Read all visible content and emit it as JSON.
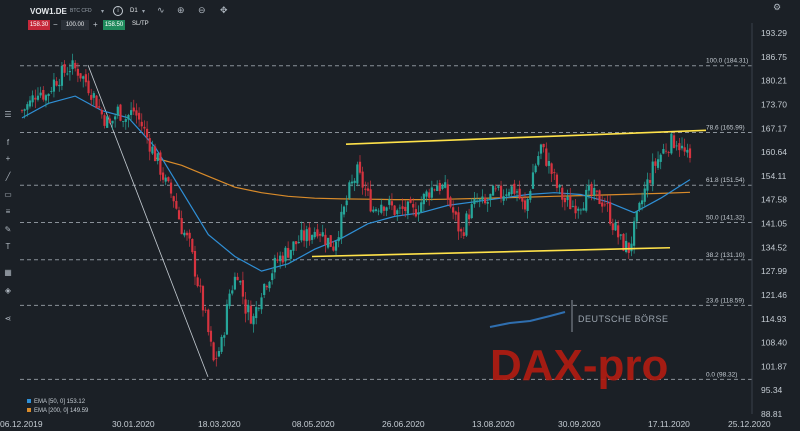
{
  "toolbar": {
    "symbol": "VOW1.DE",
    "symbol_sub": "BTC CFD",
    "timeframe": "D1",
    "sell_price": "158.30",
    "quantity": "100.00",
    "buy_price": "158.50",
    "sltp_label": "SL/TP",
    "minus": "−",
    "plus": "+",
    "icons": [
      "info-icon",
      "indicator-icon",
      "zoom-in-icon",
      "zoom-out-icon",
      "move-icon"
    ]
  },
  "sidebar_icons": [
    "menu-icon",
    "function-icon",
    "crosshair-icon",
    "line-icon",
    "rectangle-icon",
    "fibonacci-icon",
    "pen-icon",
    "text-icon",
    "grid-icon",
    "layers-icon",
    "share-icon"
  ],
  "settings_icon": "gear-icon",
  "colors": {
    "background": "#1b2026",
    "bull": "#26a69a",
    "bear": "#d6333f",
    "ema50": "#2f8fd6",
    "ema200": "#d98b2a",
    "channel": "#ffe24a",
    "fib": "#8a9199",
    "watermark": "#b01c12"
  },
  "legend": {
    "ema50": "EMA [50, 0] 153.12",
    "ema200": "EMA [200, 0] 149.59"
  },
  "watermark": {
    "deutsche": "DEUTSCHE BÖRSE",
    "daxpro": "DAX-pro"
  },
  "chart_data": {
    "type": "candlestick",
    "x_ticks": [
      "06.12.2019",
      "30.01.2020",
      "18.03.2020",
      "08.05.2020",
      "26.06.2020",
      "13.08.2020",
      "30.09.2020",
      "17.11.2020",
      "25.12.2020"
    ],
    "y_ticks": [
      193.29,
      186.75,
      180.21,
      173.7,
      167.17,
      160.64,
      154.11,
      147.58,
      141.05,
      134.52,
      127.99,
      121.46,
      114.93,
      108.4,
      101.87,
      95.34,
      88.81
    ],
    "ylim": [
      88.81,
      193.29
    ],
    "fib_levels": [
      {
        "label": "100.0 (184.31)",
        "value": 184.31
      },
      {
        "label": "78.6 (165.99)",
        "value": 165.99
      },
      {
        "label": "61.8 (151.54)",
        "value": 151.54
      },
      {
        "label": "50.0 (141.32)",
        "value": 141.32
      },
      {
        "label": "38.2 (131.10)",
        "value": 131.1
      },
      {
        "label": "23.6 (118.59)",
        "value": 118.59
      },
      {
        "label": "0.0 (98.32)",
        "value": 98.32
      }
    ],
    "channel": {
      "upper": {
        "start": [
          "08.05.2020",
          162.8
        ],
        "end": [
          "17.11.2020",
          166.6
        ]
      },
      "lower": {
        "start": [
          "08.05.2020",
          132.0
        ],
        "end": [
          "17.11.2020",
          134.4
        ]
      }
    },
    "trendline": {
      "start": [
        "06.01.2020",
        184.5
      ],
      "end": [
        "18.03.2020",
        100.5
      ]
    },
    "price": [
      [
        0,
        172
      ],
      [
        3,
        174
      ],
      [
        6,
        178
      ],
      [
        9,
        176
      ],
      [
        12,
        180
      ],
      [
        15,
        182
      ],
      [
        18,
        184
      ],
      [
        21,
        183
      ],
      [
        24,
        180
      ],
      [
        27,
        176
      ],
      [
        30,
        171
      ],
      [
        33,
        168
      ],
      [
        36,
        172
      ],
      [
        39,
        170
      ],
      [
        42,
        172
      ],
      [
        45,
        168
      ],
      [
        48,
        163
      ],
      [
        51,
        158
      ],
      [
        54,
        152
      ],
      [
        57,
        148
      ],
      [
        60,
        140
      ],
      [
        63,
        135
      ],
      [
        66,
        125
      ],
      [
        69,
        115
      ],
      [
        72,
        103
      ],
      [
        75,
        108
      ],
      [
        78,
        122
      ],
      [
        81,
        128
      ],
      [
        84,
        118
      ],
      [
        87,
        115
      ],
      [
        90,
        123
      ],
      [
        93,
        127
      ],
      [
        96,
        131
      ],
      [
        99,
        133
      ],
      [
        102,
        135
      ],
      [
        105,
        137
      ],
      [
        108,
        138
      ],
      [
        111,
        140
      ],
      [
        114,
        137
      ],
      [
        117,
        135
      ],
      [
        120,
        142
      ],
      [
        123,
        150
      ],
      [
        126,
        155
      ],
      [
        129,
        150
      ],
      [
        132,
        145
      ],
      [
        135,
        147
      ],
      [
        138,
        146
      ],
      [
        141,
        144
      ],
      [
        144,
        145
      ],
      [
        147,
        144
      ],
      [
        150,
        147
      ],
      [
        153,
        150
      ],
      [
        156,
        152
      ],
      [
        159,
        150
      ],
      [
        162,
        144
      ],
      [
        165,
        138
      ],
      [
        168,
        144
      ],
      [
        171,
        147
      ],
      [
        174,
        146
      ],
      [
        177,
        149
      ],
      [
        180,
        149
      ],
      [
        183,
        151
      ],
      [
        186,
        150
      ],
      [
        189,
        144
      ],
      [
        192,
        155
      ],
      [
        195,
        162
      ],
      [
        198,
        157
      ],
      [
        201,
        151
      ],
      [
        204,
        147
      ],
      [
        207,
        146
      ],
      [
        210,
        147
      ],
      [
        213,
        149
      ],
      [
        216,
        148
      ],
      [
        219,
        147
      ],
      [
        222,
        141
      ],
      [
        225,
        136
      ],
      [
        228,
        134
      ],
      [
        231,
        142
      ],
      [
        234,
        150
      ],
      [
        237,
        156
      ],
      [
        240,
        160
      ],
      [
        243,
        163
      ],
      [
        246,
        164
      ],
      [
        249,
        160
      ],
      [
        251,
        158
      ]
    ],
    "ema50": [
      [
        0,
        170
      ],
      [
        10,
        174
      ],
      [
        20,
        176
      ],
      [
        30,
        172
      ],
      [
        40,
        170
      ],
      [
        50,
        162
      ],
      [
        60,
        150
      ],
      [
        70,
        138
      ],
      [
        80,
        132
      ],
      [
        90,
        128
      ],
      [
        100,
        130
      ],
      [
        110,
        134
      ],
      [
        120,
        137
      ],
      [
        130,
        141
      ],
      [
        140,
        143
      ],
      [
        150,
        144
      ],
      [
        160,
        146
      ],
      [
        170,
        147
      ],
      [
        180,
        148
      ],
      [
        190,
        149
      ],
      [
        200,
        149.5
      ],
      [
        210,
        149
      ],
      [
        220,
        147
      ],
      [
        230,
        144
      ],
      [
        240,
        148
      ],
      [
        251,
        153.1
      ]
    ],
    "ema200": [
      [
        50,
        159
      ],
      [
        60,
        157
      ],
      [
        70,
        154
      ],
      [
        80,
        151
      ],
      [
        90,
        149.5
      ],
      [
        100,
        148.5
      ],
      [
        110,
        148
      ],
      [
        120,
        147.8
      ],
      [
        130,
        147.7
      ],
      [
        140,
        147.6
      ],
      [
        150,
        147.6
      ],
      [
        160,
        147.7
      ],
      [
        170,
        147.9
      ],
      [
        180,
        148.1
      ],
      [
        190,
        148.3
      ],
      [
        200,
        148.5
      ],
      [
        210,
        148.7
      ],
      [
        220,
        148.9
      ],
      [
        230,
        149.1
      ],
      [
        240,
        149.3
      ],
      [
        251,
        149.6
      ]
    ]
  }
}
